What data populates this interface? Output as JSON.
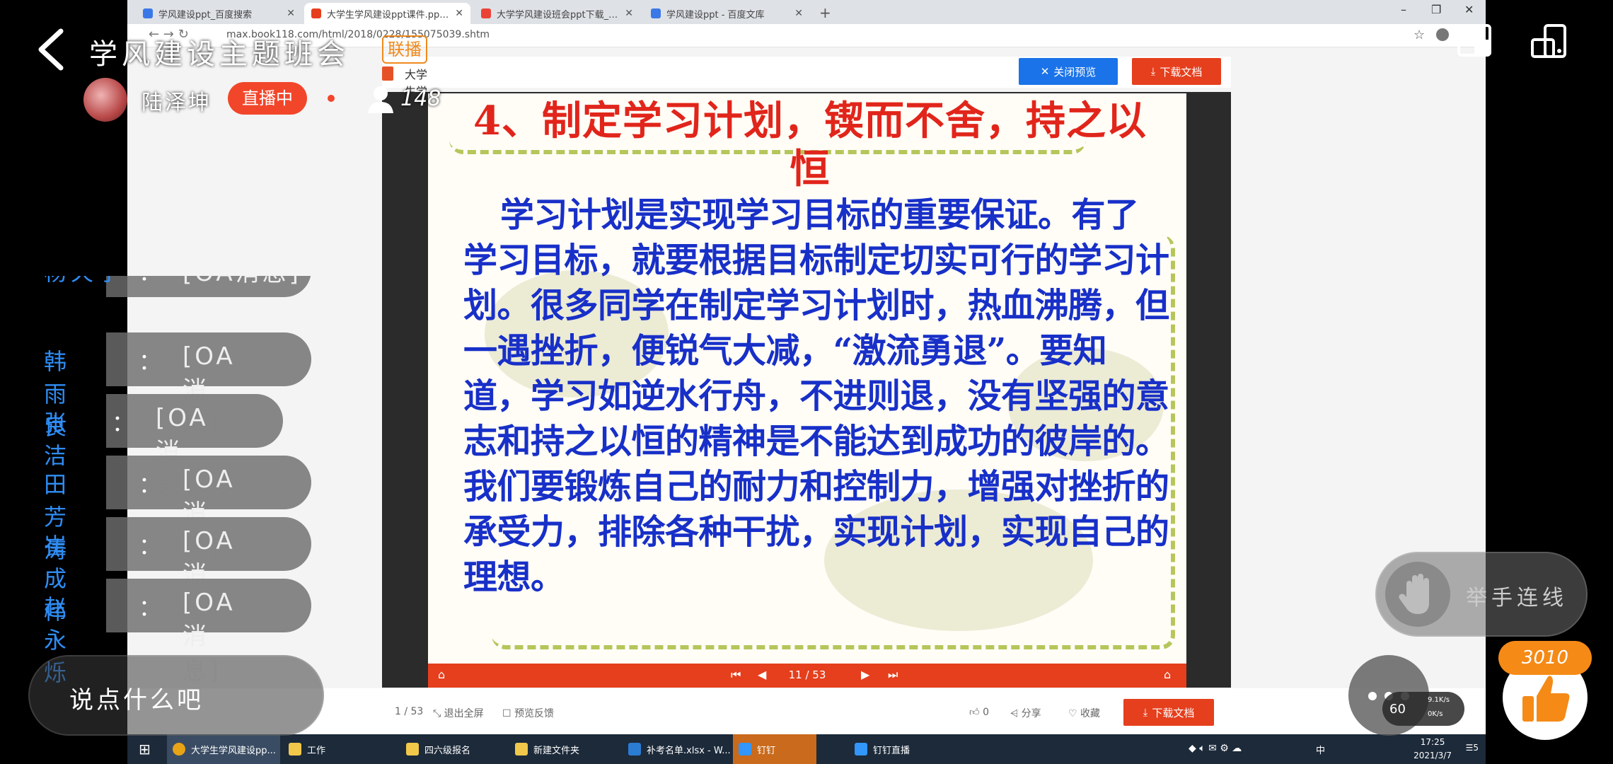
{
  "browser": {
    "tabs": [
      {
        "label": "学风建设ppt_百度搜索",
        "color": "#3b78e7",
        "active": false
      },
      {
        "label": "大学生学风建设ppt课件.ppt-原创",
        "color": "#e53f1d",
        "active": true
      },
      {
        "label": "大学学风建设班会ppt下载_PPT",
        "color": "#ea4335",
        "active": false
      },
      {
        "label": "学风建设ppt - 百度文库",
        "color": "#3b78e7",
        "active": false
      }
    ],
    "new_tab": "+",
    "url": "max.book118.com/html/2018/0228/155075039.shtm",
    "window_controls": {
      "minimize": "–",
      "maximize": "❐",
      "close": "✕"
    }
  },
  "doc": {
    "file_name": "大学生学风建设ppt课件.ppt",
    "close_preview_label": "关闭预览",
    "download_label": "下载文档",
    "slide_title": "4、制定学习计划，锲而不舍，持之以恒",
    "slide_body": "学习计划是实现学习目标的重要保证。有了学习目标，就要根据目标制定切实可行的学习计划。很多同学在制定学习计划时，热血沸腾，但一遇挫折，便锐气大减，“激流勇退”。要知道，学习如逆水行舟，不进则退，没有坚强的意志和持之以恒的精神是不能达到成功的彼岸的。我们要锻炼自己的耐力和控制力，增强对挫折的承受力，排除各种干扰，实现计划，实现自己的理想。",
    "page_indicator": "11 / 53",
    "bottom": {
      "page_count": "1 / 53",
      "exit_fullscreen": "退出全屏",
      "feedback": "预览反馈",
      "like_count": "0",
      "share": "分享",
      "collect": "收藏",
      "download": "下载文档"
    }
  },
  "taskbar": {
    "items": [
      {
        "label": "大学生学风建设pp...",
        "color": "#e8a317",
        "style": "active"
      },
      {
        "label": "工作",
        "color": "#f2c84b",
        "style": ""
      },
      {
        "label": "四六级报名",
        "color": "#f2c84b",
        "style": ""
      },
      {
        "label": "新建文件夹",
        "color": "#f2c84b",
        "style": ""
      },
      {
        "label": "补考名单.xlsx - W...",
        "color": "#2b7cd3",
        "style": ""
      },
      {
        "label": "钉钉",
        "color": "#3296fa",
        "style": "hl"
      },
      {
        "label": "钉钉直播",
        "color": "#3296fa",
        "style": ""
      }
    ],
    "time": "17:25",
    "date": "2021/3/7",
    "ime": "中",
    "notify_count": "5"
  },
  "live": {
    "title": "学风建设主题班会",
    "link_tag": "联播",
    "host_name": "陆泽坤",
    "live_badge": "直播中",
    "viewer_count": "148",
    "chat": [
      {
        "user": "杨天宇",
        "message": "[OA消息]"
      },
      {
        "user": "韩雨良",
        "message": "[OA消息]"
      },
      {
        "user": "张洁",
        "message": "[OA消息]"
      },
      {
        "user": "田芳涛",
        "message": "[OA消息]"
      },
      {
        "user": "崔成伟",
        "message": "[OA消息]"
      },
      {
        "user": "赵永烁",
        "message": "[OA消息]"
      }
    ],
    "chat_separator": "：",
    "input_placeholder": "说点什么吧",
    "raise_hand_label": "举手连线",
    "like_count": "3010",
    "net": {
      "fps": "60",
      "up": "9.1K/s",
      "down": "0K/s"
    }
  },
  "colors": {
    "accent": "#e53f1d",
    "live_red": "#f2462b",
    "chat_user": "#2f8df5",
    "like_orange": "#f58a16",
    "slide_title": "#e1251b",
    "slide_body": "#1830c8"
  }
}
